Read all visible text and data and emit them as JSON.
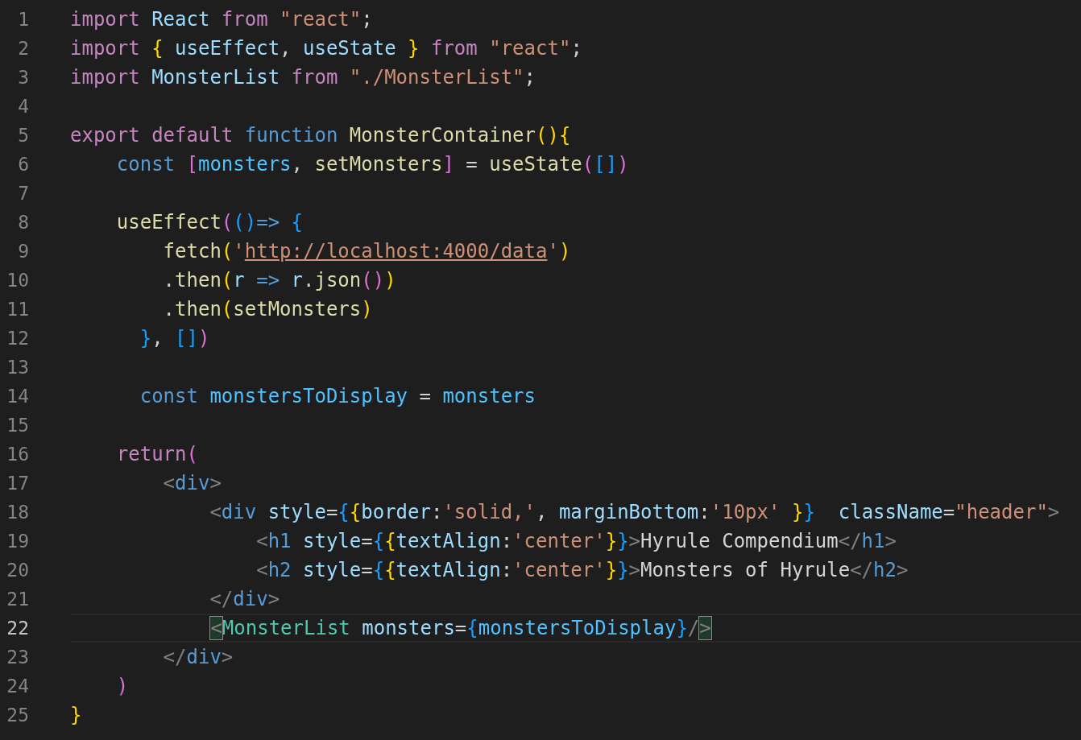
{
  "editor": {
    "lines": [
      {
        "number": "1",
        "current": false,
        "tokens": [
          {
            "text": "import",
            "color": "#c586c0"
          },
          {
            "text": " React",
            "color": "#9cdcfe"
          },
          {
            "text": " from",
            "color": "#c586c0"
          },
          {
            "text": " \"react\"",
            "color": "#ce9178"
          },
          {
            "text": ";",
            "color": "#d4d4d4"
          }
        ]
      },
      {
        "number": "2",
        "current": false,
        "tokens": [
          {
            "text": "import",
            "color": "#c586c0"
          },
          {
            "text": " {",
            "color": "#ffd700"
          },
          {
            "text": " useEffect",
            "color": "#9cdcfe"
          },
          {
            "text": ",",
            "color": "#d4d4d4"
          },
          {
            "text": " useState",
            "color": "#9cdcfe"
          },
          {
            "text": " }",
            "color": "#ffd700"
          },
          {
            "text": " from",
            "color": "#c586c0"
          },
          {
            "text": " \"react\"",
            "color": "#ce9178"
          },
          {
            "text": ";",
            "color": "#d4d4d4"
          }
        ]
      },
      {
        "number": "3",
        "current": false,
        "tokens": [
          {
            "text": "import",
            "color": "#c586c0"
          },
          {
            "text": " MonsterList",
            "color": "#9cdcfe"
          },
          {
            "text": " from",
            "color": "#c586c0"
          },
          {
            "text": " \"./MonsterList\"",
            "color": "#ce9178"
          },
          {
            "text": ";",
            "color": "#d4d4d4"
          }
        ]
      },
      {
        "number": "4",
        "current": false
      },
      {
        "number": "5",
        "current": false,
        "tokens": [
          {
            "text": "export default",
            "color": "#c586c0"
          },
          {
            "text": " function",
            "color": "#569cd6"
          },
          {
            "text": " MonsterContainer",
            "color": "#dcdcaa"
          },
          {
            "text": "(){",
            "color": "#ffd700"
          }
        ]
      },
      {
        "number": "6",
        "current": false,
        "tokens": [
          {
            "text": "    const",
            "color": "#569cd6"
          },
          {
            "text": " [",
            "color": "#da70d6"
          },
          {
            "text": "monsters",
            "color": "#4fc1ff"
          },
          {
            "text": ",",
            "color": "#d4d4d4"
          },
          {
            "text": " setMonsters",
            "color": "#dcdcaa"
          },
          {
            "text": "]",
            "color": "#da70d6"
          },
          {
            "text": " =",
            "color": "#d4d4d4"
          },
          {
            "text": " useState",
            "color": "#dcdcaa"
          },
          {
            "text": "(",
            "color": "#da70d6"
          },
          {
            "text": "[]",
            "color": "#179fff"
          },
          {
            "text": ")",
            "color": "#da70d6"
          }
        ]
      },
      {
        "number": "7",
        "current": false
      },
      {
        "number": "8",
        "current": false,
        "tokens": [
          {
            "text": "    useEffect",
            "color": "#dcdcaa"
          },
          {
            "text": "(",
            "color": "#da70d6"
          },
          {
            "text": "()",
            "color": "#179fff"
          },
          {
            "text": "=>",
            "color": "#569cd6"
          },
          {
            "text": " {",
            "color": "#179fff"
          }
        ]
      },
      {
        "number": "9",
        "current": false,
        "tokens": [
          {
            "text": "        fetch",
            "color": "#dcdcaa"
          },
          {
            "text": "(",
            "color": "#ffd700"
          },
          {
            "text": "'",
            "color": "#ce9178"
          },
          {
            "text": "http://localhost:4000/data",
            "color": "#ce9178",
            "kind": "link"
          },
          {
            "text": "'",
            "color": "#ce9178"
          },
          {
            "text": ")",
            "color": "#ffd700"
          }
        ]
      },
      {
        "number": "10",
        "current": false,
        "tokens": [
          {
            "text": "        .",
            "color": "#d4d4d4"
          },
          {
            "text": "then",
            "color": "#dcdcaa"
          },
          {
            "text": "(",
            "color": "#ffd700"
          },
          {
            "text": "r",
            "color": "#9cdcfe"
          },
          {
            "text": " =>",
            "color": "#569cd6"
          },
          {
            "text": " r",
            "color": "#9cdcfe"
          },
          {
            "text": ".",
            "color": "#d4d4d4"
          },
          {
            "text": "json",
            "color": "#dcdcaa"
          },
          {
            "text": "()",
            "color": "#da70d6"
          },
          {
            "text": ")",
            "color": "#ffd700"
          }
        ]
      },
      {
        "number": "11",
        "current": false,
        "tokens": [
          {
            "text": "        .",
            "color": "#d4d4d4"
          },
          {
            "text": "then",
            "color": "#dcdcaa"
          },
          {
            "text": "(",
            "color": "#ffd700"
          },
          {
            "text": "setMonsters",
            "color": "#dcdcaa"
          },
          {
            "text": ")",
            "color": "#ffd700"
          }
        ]
      },
      {
        "number": "12",
        "current": false,
        "tokens": [
          {
            "text": "      }",
            "color": "#179fff"
          },
          {
            "text": ",",
            "color": "#d4d4d4"
          },
          {
            "text": " []",
            "color": "#179fff"
          },
          {
            "text": ")",
            "color": "#da70d6"
          }
        ]
      },
      {
        "number": "13",
        "current": false
      },
      {
        "number": "14",
        "current": false,
        "tokens": [
          {
            "text": "      const",
            "color": "#569cd6"
          },
          {
            "text": " monstersToDisplay",
            "color": "#4fc1ff"
          },
          {
            "text": " =",
            "color": "#d4d4d4"
          },
          {
            "text": " monsters",
            "color": "#4fc1ff"
          }
        ]
      },
      {
        "number": "15",
        "current": false
      },
      {
        "number": "16",
        "current": false,
        "tokens": [
          {
            "text": "    return",
            "color": "#c586c0"
          },
          {
            "text": "(",
            "color": "#da70d6"
          }
        ]
      },
      {
        "number": "17",
        "current": false,
        "tokens": [
          {
            "text": "        <",
            "color": "#808080"
          },
          {
            "text": "div",
            "color": "#569cd6"
          },
          {
            "text": ">",
            "color": "#808080"
          }
        ]
      },
      {
        "number": "18",
        "current": false,
        "tokens": [
          {
            "text": "            <",
            "color": "#808080"
          },
          {
            "text": "div",
            "color": "#569cd6"
          },
          {
            "text": " style",
            "color": "#9cdcfe"
          },
          {
            "text": "=",
            "color": "#d4d4d4"
          },
          {
            "text": "{",
            "color": "#179fff"
          },
          {
            "text": "{",
            "color": "#ffd700"
          },
          {
            "text": "border",
            "color": "#9cdcfe"
          },
          {
            "text": ":",
            "color": "#d4d4d4"
          },
          {
            "text": "'solid,'",
            "color": "#ce9178"
          },
          {
            "text": ",",
            "color": "#d4d4d4"
          },
          {
            "text": " marginBottom",
            "color": "#9cdcfe"
          },
          {
            "text": ":",
            "color": "#d4d4d4"
          },
          {
            "text": "'10px'",
            "color": "#ce9178"
          },
          {
            "text": " }",
            "color": "#ffd700"
          },
          {
            "text": "}",
            "color": "#179fff"
          },
          {
            "text": "  className",
            "color": "#9cdcfe"
          },
          {
            "text": "=",
            "color": "#d4d4d4"
          },
          {
            "text": "\"header\"",
            "color": "#ce9178"
          },
          {
            "text": ">",
            "color": "#808080"
          }
        ]
      },
      {
        "number": "19",
        "current": false,
        "tokens": [
          {
            "text": "                <",
            "color": "#808080"
          },
          {
            "text": "h1",
            "color": "#569cd6"
          },
          {
            "text": " style",
            "color": "#9cdcfe"
          },
          {
            "text": "=",
            "color": "#d4d4d4"
          },
          {
            "text": "{",
            "color": "#179fff"
          },
          {
            "text": "{",
            "color": "#ffd700"
          },
          {
            "text": "textAlign",
            "color": "#9cdcfe"
          },
          {
            "text": ":",
            "color": "#d4d4d4"
          },
          {
            "text": "'center'",
            "color": "#ce9178"
          },
          {
            "text": "}",
            "color": "#ffd700"
          },
          {
            "text": "}",
            "color": "#179fff"
          },
          {
            "text": ">",
            "color": "#808080"
          },
          {
            "text": "Hyrule Compendium",
            "color": "#d4d4d4"
          },
          {
            "text": "</",
            "color": "#808080"
          },
          {
            "text": "h1",
            "color": "#569cd6"
          },
          {
            "text": ">",
            "color": "#808080"
          }
        ]
      },
      {
        "number": "20",
        "current": false,
        "tokens": [
          {
            "text": "                <",
            "color": "#808080"
          },
          {
            "text": "h2",
            "color": "#569cd6"
          },
          {
            "text": " style",
            "color": "#9cdcfe"
          },
          {
            "text": "=",
            "color": "#d4d4d4"
          },
          {
            "text": "{",
            "color": "#179fff"
          },
          {
            "text": "{",
            "color": "#ffd700"
          },
          {
            "text": "textAlign",
            "color": "#9cdcfe"
          },
          {
            "text": ":",
            "color": "#d4d4d4"
          },
          {
            "text": "'center'",
            "color": "#ce9178"
          },
          {
            "text": "}",
            "color": "#ffd700"
          },
          {
            "text": "}",
            "color": "#179fff"
          },
          {
            "text": ">",
            "color": "#808080"
          },
          {
            "text": "Monsters of Hyrule",
            "color": "#d4d4d4"
          },
          {
            "text": "</",
            "color": "#808080"
          },
          {
            "text": "h2",
            "color": "#569cd6"
          },
          {
            "text": ">",
            "color": "#808080"
          }
        ]
      },
      {
        "number": "21",
        "current": false,
        "tokens": [
          {
            "text": "            </",
            "color": "#808080"
          },
          {
            "text": "div",
            "color": "#569cd6"
          },
          {
            "text": ">",
            "color": "#808080"
          }
        ]
      },
      {
        "number": "22",
        "current": true,
        "tokens": [
          {
            "text": "            <",
            "color": "#808080",
            "highlighted": true
          },
          {
            "text": "MonsterList",
            "color": "#4ec9b0",
            "highlighted": false
          },
          {
            "text": " monsters",
            "color": "#9cdcfe",
            "highlighted": false
          },
          {
            "text": "=",
            "color": "#d4d4d4",
            "highlighted": false
          },
          {
            "text": "{",
            "color": "#179fff",
            "highlighted": false
          },
          {
            "text": "monstersToDisplay",
            "color": "#4fc1ff",
            "highlighted": false
          },
          {
            "text": "}",
            "color": "#179fff",
            "highlighted": false
          },
          {
            "text": "/",
            "color": "#808080",
            "highlighted": false
          },
          {
            "text": ">",
            "color": "#808080",
            "highlighted": true
          }
        ]
      },
      {
        "number": "23",
        "current": false,
        "tokens": [
          {
            "text": "        </",
            "color": "#808080"
          },
          {
            "text": "div",
            "color": "#569cd6"
          },
          {
            "text": ">",
            "color": "#808080"
          }
        ]
      },
      {
        "number": "24",
        "current": false,
        "tokens": [
          {
            "text": "    )",
            "color": "#da70d6"
          }
        ]
      },
      {
        "number": "25",
        "current": false,
        "tokens": [
          {
            "text": "}",
            "color": "#ffd700"
          }
        ]
      }
    ]
  }
}
